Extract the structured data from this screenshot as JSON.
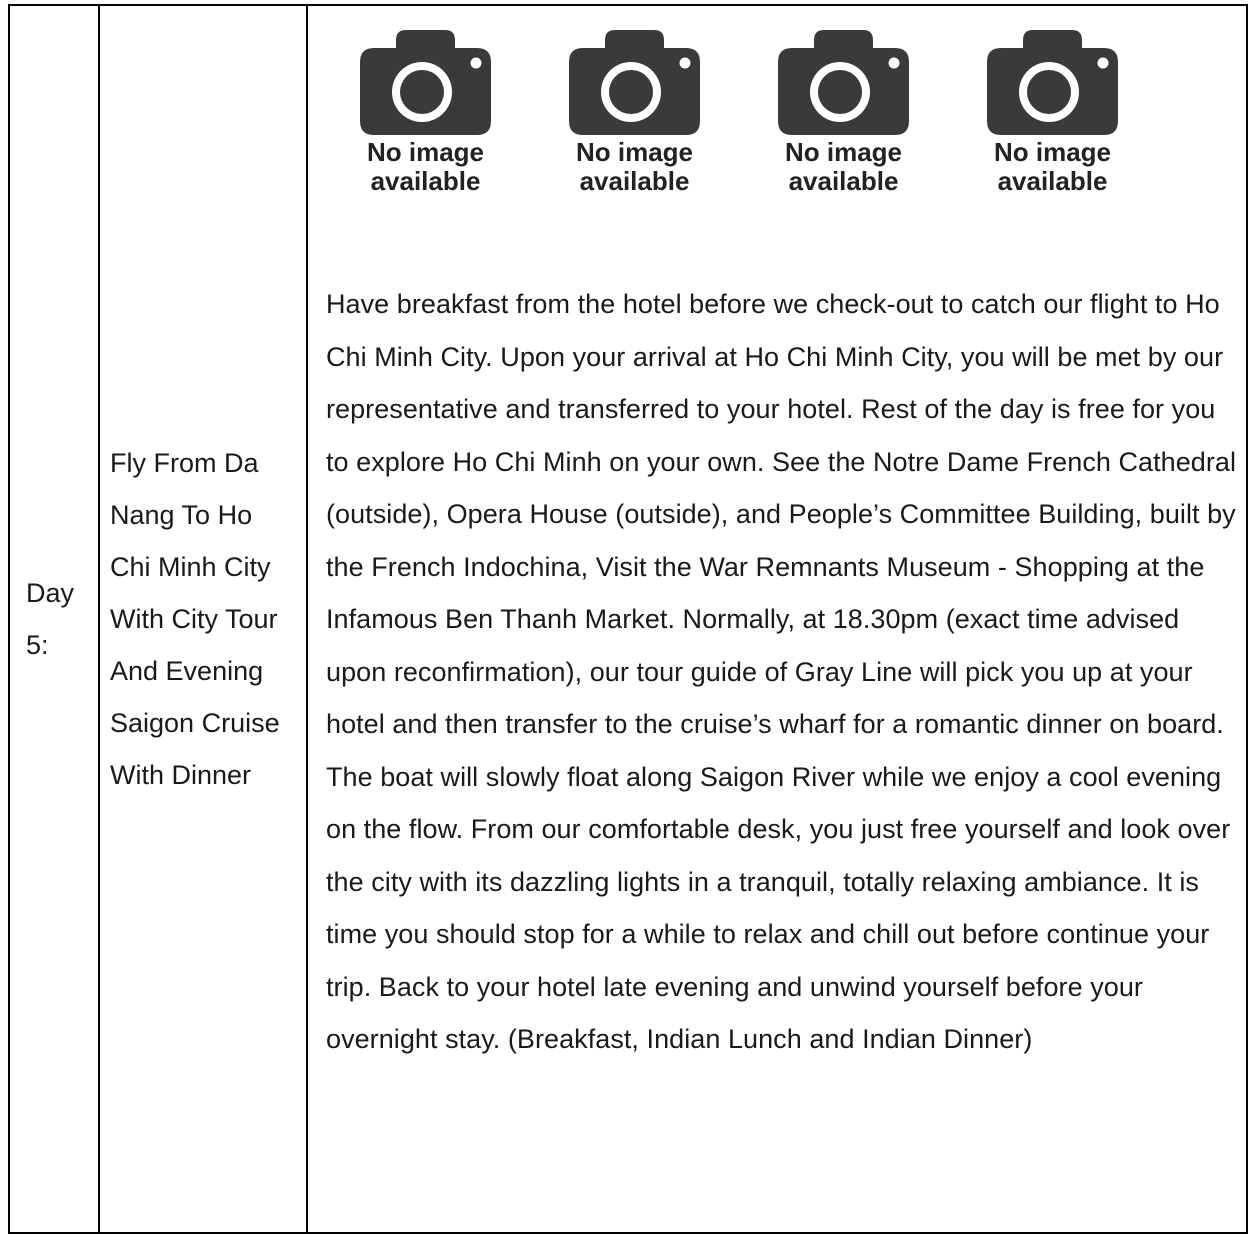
{
  "day": {
    "label": "Day 5:"
  },
  "title": "Fly From Da Nang To Ho Chi Minh City With City Tour And Evening Saigon Cruise With Dinner",
  "images": [
    {
      "icon": "camera-icon",
      "line1": "No image",
      "line2": "available"
    },
    {
      "icon": "camera-icon",
      "line1": "No image",
      "line2": "available"
    },
    {
      "icon": "camera-icon",
      "line1": "No image",
      "line2": "available"
    },
    {
      "icon": "camera-icon",
      "line1": "No image",
      "line2": "available"
    }
  ],
  "description": "Have breakfast from the hotel before we check-out to catch our flight to Ho Chi Minh City. Upon your arrival at Ho Chi Minh City, you will be met by our representative and transferred to your hotel. Rest of the day is free for you to explore Ho Chi Minh on your own. See the Notre Dame French Cathedral (outside), Opera House (outside), and People’s Committee Building, built by the French Indochina, Visit the War Remnants Museum - Shopping at the Infamous Ben Thanh Market. Normally, at 18.30pm (exact time advised upon reconfirmation), our tour guide of Gray Line will pick you up at your hotel and then transfer to the cruise’s wharf for a romantic dinner on board. The boat will slowly float along Saigon River while we enjoy a cool evening on the flow. From our comfortable desk, you just free yourself and look over the city with its dazzling lights in a tranquil, totally relaxing ambiance. It is time you should stop for a while to relax and chill out before continue your trip. Back to your hotel late evening and unwind yourself before your overnight stay. (Breakfast, Indian Lunch and Indian Dinner)",
  "colors": {
    "icon": "#3a3a3a",
    "border": "#000000",
    "text": "#1a1a1a"
  }
}
